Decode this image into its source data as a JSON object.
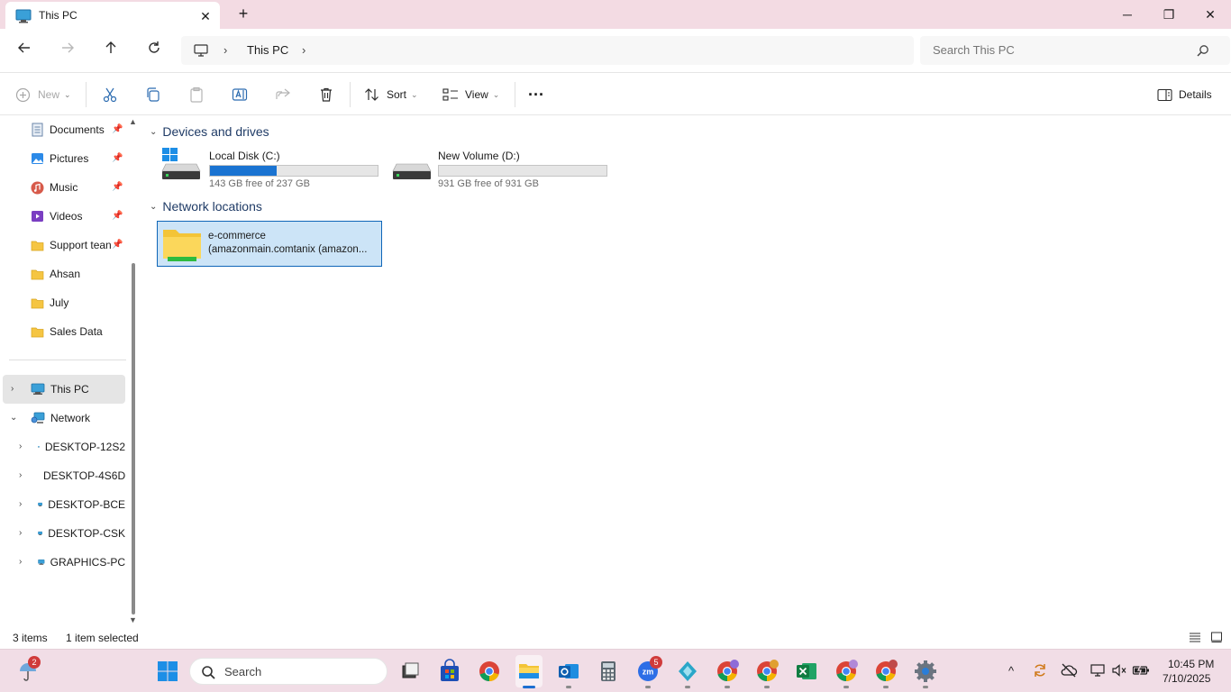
{
  "window": {
    "tab_title": "This PC",
    "new_tab_label": "+",
    "close_tab_label": "✕",
    "minimize_label": "─",
    "maximize_label": "❐",
    "close_label": "✕"
  },
  "address": {
    "crumbs": [
      "This PC"
    ],
    "search_placeholder": "Search This PC"
  },
  "commands": {
    "new": "New",
    "sort": "Sort",
    "view": "View",
    "more": "···",
    "details": "Details"
  },
  "sidebar": {
    "quick_access": [
      {
        "label": "Documents",
        "icon": "documents-icon",
        "pinned": true
      },
      {
        "label": "Pictures",
        "icon": "pictures-icon",
        "pinned": true
      },
      {
        "label": "Music",
        "icon": "music-icon",
        "pinned": true
      },
      {
        "label": "Videos",
        "icon": "videos-icon",
        "pinned": true
      },
      {
        "label": "Support tean",
        "icon": "folder-icon",
        "pinned": true
      },
      {
        "label": "Ahsan",
        "icon": "folder-icon",
        "pinned": false
      },
      {
        "label": "July",
        "icon": "folder-icon",
        "pinned": false
      },
      {
        "label": "Sales Data",
        "icon": "folder-icon",
        "pinned": false
      }
    ],
    "this_pc": "This PC",
    "network": "Network",
    "network_items": [
      "DESKTOP-12S2",
      "DESKTOP-4S6D",
      "DESKTOP-BCE",
      "DESKTOP-CSK",
      "GRAPHICS-PC"
    ]
  },
  "content": {
    "devices_header": "Devices and drives",
    "drives": [
      {
        "name": "Local Disk (C:)",
        "free_text": "143 GB free of 237 GB",
        "used_fraction": 0.397,
        "system": true
      },
      {
        "name": "New Volume (D:)",
        "free_text": "931 GB free of 931 GB",
        "used_fraction": 0.0,
        "system": false
      }
    ],
    "network_header": "Network locations",
    "network_location": {
      "name": "e-commerce",
      "sub": "(amazonmain.comtanix (amazon..."
    }
  },
  "status": {
    "count": "3 items",
    "selection": "1 item selected"
  },
  "taskbar": {
    "search_label": "Search",
    "weather_badge": "2",
    "zoom_badge": "5",
    "time": "10:45 PM",
    "date": "7/10/2025"
  },
  "colors": {
    "accent": "#1a73d1",
    "selection_bg": "#cce4f7",
    "titlebar": "#f3dbe3",
    "taskbar": "#f1dde6"
  }
}
